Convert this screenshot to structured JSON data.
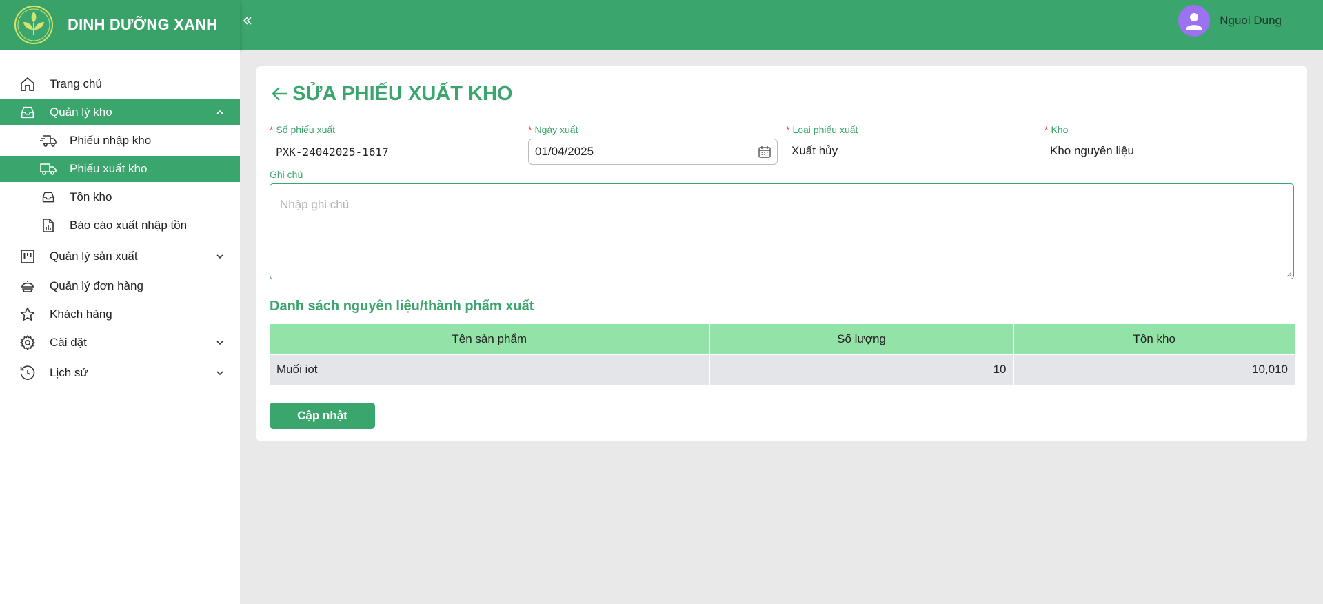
{
  "brand": {
    "name": "DINH DƯỠNG XANH",
    "collapse_icon": "double-chevron-left-icon"
  },
  "user": {
    "name": "Nguoi Dung",
    "avatar_color": "#9b72f0"
  },
  "colors": {
    "primary": "#3aa56c",
    "table_header": "#93e2a7",
    "required": "#e53935"
  },
  "sidebar": {
    "items": [
      {
        "label": "Trang chủ",
        "icon": "home-icon"
      },
      {
        "label": "Quản lý kho",
        "icon": "inbox-icon",
        "active": true,
        "expanded": true
      },
      {
        "label": "Phiếu nhập kho",
        "icon": "truck-in-icon",
        "sub": true
      },
      {
        "label": "Phiếu xuất kho",
        "icon": "truck-out-icon",
        "sub": true,
        "active": true
      },
      {
        "label": "Tồn kho",
        "icon": "inbox-icon",
        "sub": true
      },
      {
        "label": "Báo cáo xuất nhập tồn",
        "icon": "report-icon",
        "sub": true
      },
      {
        "label": "Quản lý sản xuất",
        "icon": "kanban-icon",
        "expandable": true
      },
      {
        "label": "Quản lý đơn hàng",
        "icon": "order-icon"
      },
      {
        "label": "Khách hàng",
        "icon": "star-icon"
      },
      {
        "label": "Cài đặt",
        "icon": "gear-icon",
        "expandable": true
      },
      {
        "label": "Lịch sử",
        "icon": "clock-icon",
        "expandable": true
      }
    ]
  },
  "page": {
    "title": "SỬA PHIẾU XUẤT KHO",
    "fields": {
      "so_phieu": {
        "label": "Số phiếu xuất",
        "value": "PXK-24042025-1617"
      },
      "ngay_xuat": {
        "label": "Ngày xuất",
        "value": "01/04/2025"
      },
      "loai_phieu": {
        "label": "Loại phiếu xuất",
        "value": "Xuất hủy"
      },
      "kho": {
        "label": "Kho",
        "value": "Kho nguyên liệu"
      },
      "ghi_chu": {
        "label": "Ghi chú",
        "placeholder": "Nhập ghi chú"
      }
    },
    "section_title": "Danh sách nguyên liệu/thành phẩm xuất",
    "table": {
      "headers": [
        "Tên sản phẩm",
        "Số lượng",
        "Tồn kho"
      ],
      "rows": [
        [
          "Muối iot",
          "10",
          "10,010"
        ]
      ]
    },
    "update_button": "Cập nhật"
  }
}
